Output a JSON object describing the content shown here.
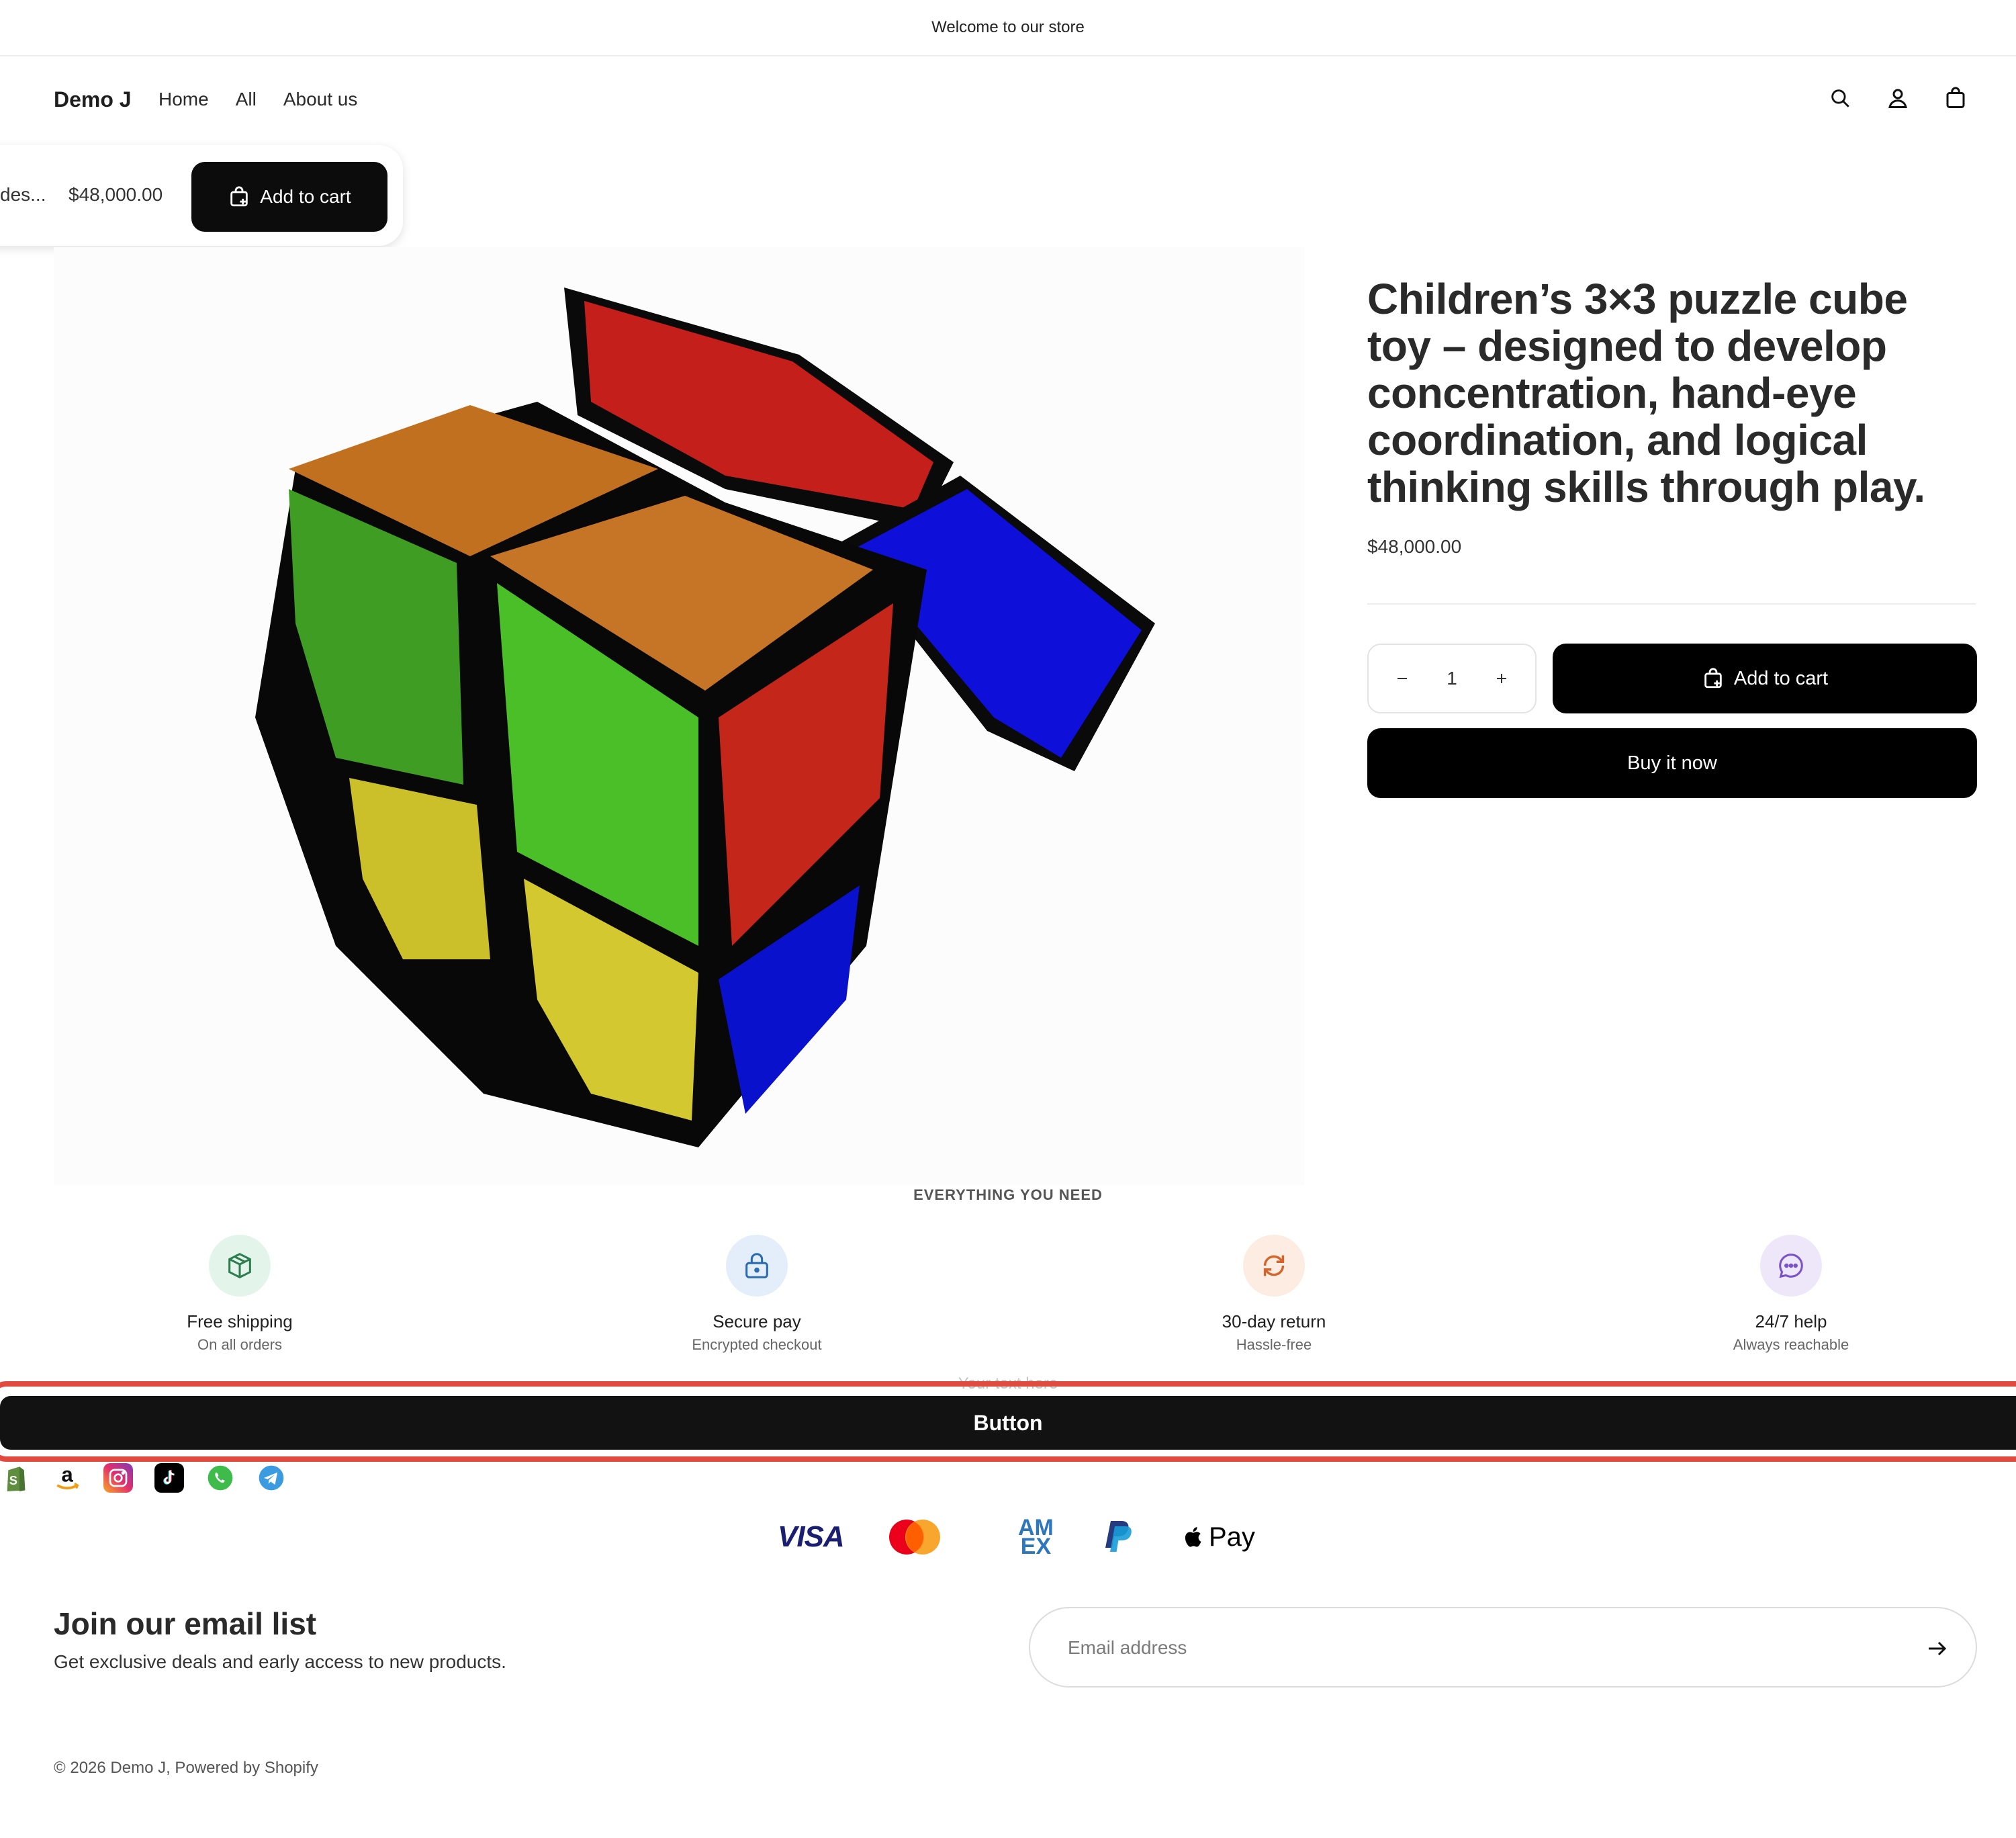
{
  "announcement": "Welcome to our store",
  "header": {
    "logo": "Demo J",
    "nav": [
      "Home",
      "All",
      "About us"
    ],
    "icons": [
      "search-icon",
      "account-icon",
      "cart-icon"
    ]
  },
  "sticky_bar": {
    "title_fragment": "des...",
    "price": "$48,000.00",
    "add_to_cart": "Add to cart"
  },
  "product": {
    "title": "Children’s 3×3 puzzle cube toy – designed to develop concentration, hand-eye coordination, and logical thinking skills through play.",
    "price": "$48,000.00",
    "quantity": "1",
    "add_to_cart": "Add to cart",
    "buy_now": "Buy it now"
  },
  "features": {
    "heading": "EVERYTHING YOU NEED",
    "items": [
      {
        "title": "Free shipping",
        "subtitle": "On all orders",
        "icon": "box-icon",
        "color": "#2e7d4f",
        "bg": "#e3f5ea"
      },
      {
        "title": "Secure pay",
        "subtitle": "Encrypted checkout",
        "icon": "lock-icon",
        "color": "#2b6cb0",
        "bg": "#e3eefa"
      },
      {
        "title": "30-day return",
        "subtitle": "Hassle-free",
        "icon": "refresh-icon",
        "color": "#d2652b",
        "bg": "#fcece1"
      },
      {
        "title": "24/7 help",
        "subtitle": "Always reachable",
        "icon": "chat-icon",
        "color": "#7a53c9",
        "bg": "#eee7fa"
      }
    ]
  },
  "cta": {
    "placeholder_text": "Your text here",
    "button_label": "Button",
    "highlight_color": "#e04a3f"
  },
  "social_icons": [
    "shopify-icon",
    "amazon-icon",
    "instagram-icon",
    "tiktok-icon",
    "whatsapp-icon",
    "telegram-icon"
  ],
  "payments": {
    "visa": "VISA",
    "amex_top": "AM",
    "amex_bottom": "EX",
    "apple_pay": "Pay",
    "icons": [
      "visa-icon",
      "mastercard-icon",
      "amex-icon",
      "paypal-icon",
      "apple-pay-icon"
    ]
  },
  "newsletter": {
    "title": "Join our email list",
    "subtitle": "Get exclusive deals and early access to new products.",
    "placeholder": "Email address"
  },
  "footer": {
    "copyright": "© 2026 Demo J, Powered by Shopify"
  }
}
